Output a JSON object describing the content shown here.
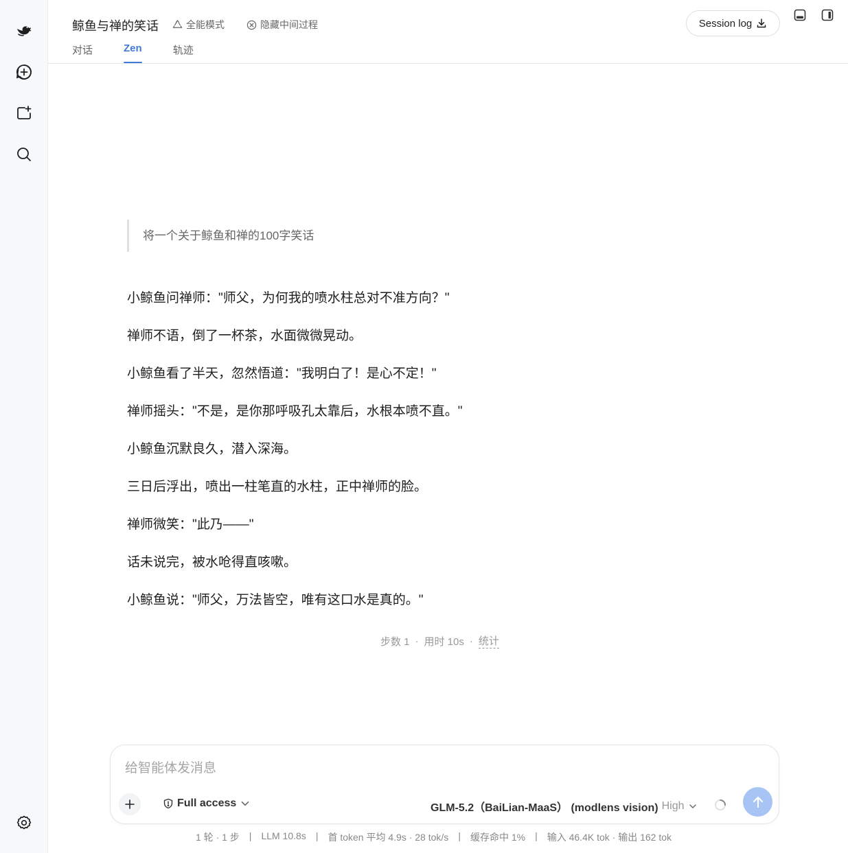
{
  "sidebar": {
    "items": [
      {
        "icon": "whale-logo-icon"
      },
      {
        "icon": "new-chat-icon"
      },
      {
        "icon": "new-workspace-icon"
      },
      {
        "icon": "search-icon"
      },
      {
        "icon": "settings-icon"
      }
    ]
  },
  "header": {
    "title": "鲸鱼与禅的笑话",
    "mode_label": "全能模式",
    "hide_label": "隐藏中间过程",
    "tabs": [
      {
        "label": "对话",
        "active": false
      },
      {
        "label": "Zen",
        "active": true
      },
      {
        "label": "轨迹",
        "active": false
      }
    ],
    "session_log_label": "Session log"
  },
  "main": {
    "user_prompt": "将一个关于鲸鱼和禅的100字笑话",
    "response_lines": [
      "小鲸鱼问禅师：\"师父，为何我的喷水柱总对不准方向？\"",
      "禅师不语，倒了一杯茶，水面微微晃动。",
      "小鲸鱼看了半天，忽然悟道：\"我明白了！是心不定！\"",
      "禅师摇头：\"不是，是你那呼吸孔太靠后，水根本喷不直。\"",
      "小鲸鱼沉默良久，潜入深海。",
      "三日后浮出，喷出一柱笔直的水柱，正中禅师的脸。",
      "禅师微笑：\"此乃——\"",
      "话未说完，被水呛得直咳嗽。",
      "小鲸鱼说：\"师父，万法皆空，唯有这口水是真的。\""
    ],
    "stats": {
      "steps": "步数 1",
      "dot1": "·",
      "time": "用时 10s",
      "dot2": "·",
      "link": "统计"
    }
  },
  "composer": {
    "placeholder": "给智能体发消息",
    "access_label": "Full access",
    "model_label": "GLM-5.2（BaiLian-MaaS） (modlens vision)",
    "model_level": "High"
  },
  "footer": {
    "items": [
      "1 轮 · 1 步",
      "|",
      "LLM 10.8s",
      "|",
      "首 token 平均 4.9s · 28 tok/s",
      "|",
      "缓存命中 1%",
      "|",
      "输入 46.4K tok · 输出 162 tok"
    ]
  },
  "colors": {
    "accent": "#3f7bd6",
    "send_button": "#a8c4f5",
    "sidebar_bg": "#f7f8fa"
  }
}
